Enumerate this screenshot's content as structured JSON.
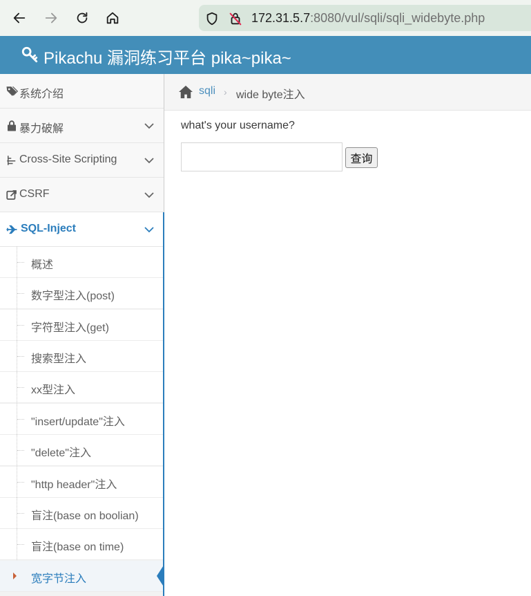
{
  "browser": {
    "url_host": "172.31.5.7",
    "url_rest": ":8080/vul/sqli/sqli_widebyte.php"
  },
  "header": {
    "title": "Pikachu 漏洞练习平台 pika~pika~"
  },
  "sidebar": {
    "items": [
      {
        "label": "系统介绍",
        "icon": "tags-icon"
      },
      {
        "label": "暴力破解",
        "icon": "lock-icon"
      },
      {
        "label": "Cross-Site Scripting",
        "icon": "list-tree-icon"
      },
      {
        "label": "CSRF",
        "icon": "share-icon"
      },
      {
        "label": "SQL-Inject",
        "icon": "plane-icon"
      }
    ],
    "submenu": [
      {
        "label": "概述"
      },
      {
        "label": "数字型注入(post)"
      },
      {
        "label": "字符型注入(get)"
      },
      {
        "label": "搜索型注入"
      },
      {
        "label": "xx型注入"
      },
      {
        "label": "\"insert/update\"注入"
      },
      {
        "label": "\"delete\"注入"
      },
      {
        "label": "\"http header\"注入"
      },
      {
        "label": "盲注(base on boolian)"
      },
      {
        "label": "盲注(base on time)"
      },
      {
        "label": "宽字节注入"
      }
    ]
  },
  "breadcrumb": {
    "link": "sqli",
    "current": "wide byte注入"
  },
  "main": {
    "prompt": "what's your username?",
    "input_value": "",
    "button_label": "查询"
  },
  "colors": {
    "header_bg": "#438eb9",
    "accent": "#2b7dbc"
  }
}
